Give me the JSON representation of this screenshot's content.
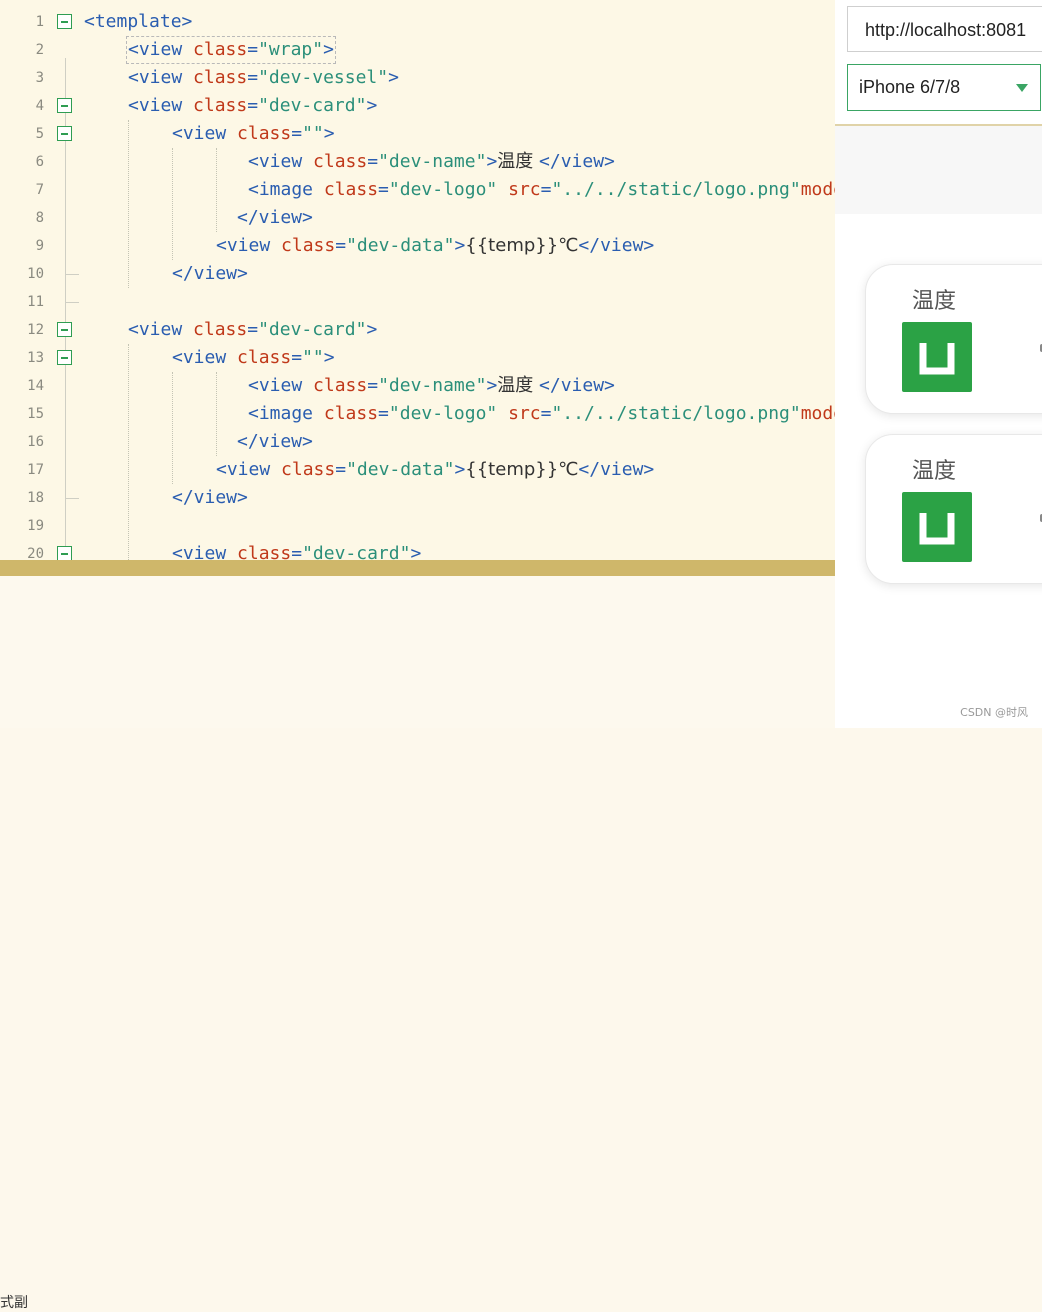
{
  "editor": {
    "lines": [
      {
        "n": "1",
        "fold": true,
        "indent": 84,
        "parts": [
          [
            "tag",
            "<template>"
          ]
        ]
      },
      {
        "n": "2",
        "fold": false,
        "indent": 128,
        "hl": true,
        "parts": [
          [
            "tag",
            "<view "
          ],
          [
            "attr",
            "class"
          ],
          [
            "tag",
            "="
          ],
          [
            "val",
            "\"wrap\""
          ],
          [
            "tag",
            ">"
          ]
        ]
      },
      {
        "n": "3",
        "fold": false,
        "indent": 128,
        "parts": [
          [
            "tag",
            "<view "
          ],
          [
            "attr",
            "class"
          ],
          [
            "tag",
            "="
          ],
          [
            "val",
            "\"dev-vessel\""
          ],
          [
            "tag",
            ">"
          ]
        ]
      },
      {
        "n": "4",
        "fold": true,
        "indent": 128,
        "parts": [
          [
            "tag",
            "<view "
          ],
          [
            "attr",
            "class"
          ],
          [
            "tag",
            "="
          ],
          [
            "val",
            "\"dev-card\""
          ],
          [
            "tag",
            ">"
          ]
        ]
      },
      {
        "n": "5",
        "fold": true,
        "indent": 172,
        "parts": [
          [
            "tag",
            "<view "
          ],
          [
            "attr",
            "class"
          ],
          [
            "tag",
            "="
          ],
          [
            "val",
            "\"\""
          ],
          [
            "tag",
            ">"
          ]
        ]
      },
      {
        "n": "6",
        "fold": false,
        "indent": 248,
        "parts": [
          [
            "tag",
            "<view "
          ],
          [
            "attr",
            "class"
          ],
          [
            "tag",
            "="
          ],
          [
            "val",
            "\"dev-name\""
          ],
          [
            "tag",
            ">"
          ],
          [
            "txt",
            "温度 "
          ],
          [
            "tag",
            "</view>"
          ]
        ]
      },
      {
        "n": "7",
        "fold": false,
        "indent": 248,
        "parts": [
          [
            "tag",
            "<image "
          ],
          [
            "attr",
            "class"
          ],
          [
            "tag",
            "="
          ],
          [
            "val",
            "\"dev-logo\""
          ],
          [
            "tag",
            " "
          ],
          [
            "attr",
            "src"
          ],
          [
            "tag",
            "="
          ],
          [
            "val",
            "\"../../static/logo.png\""
          ],
          [
            "attr",
            "mode"
          ]
        ]
      },
      {
        "n": "8",
        "fold": false,
        "indent": 237,
        "parts": [
          [
            "tag",
            "</view>"
          ]
        ]
      },
      {
        "n": "9",
        "fold": false,
        "indent": 216,
        "parts": [
          [
            "tag",
            "<view "
          ],
          [
            "attr",
            "class"
          ],
          [
            "tag",
            "="
          ],
          [
            "val",
            "\"dev-data\""
          ],
          [
            "tag",
            ">"
          ],
          [
            "txt",
            "{{temp}}℃"
          ],
          [
            "tag",
            "</view>"
          ]
        ]
      },
      {
        "n": "10",
        "fold": false,
        "indent": 172,
        "parts": [
          [
            "tag",
            "</view>"
          ]
        ]
      },
      {
        "n": "11",
        "fold": false,
        "indent": 0,
        "parts": []
      },
      {
        "n": "12",
        "fold": true,
        "indent": 128,
        "parts": [
          [
            "tag",
            "<view "
          ],
          [
            "attr",
            "class"
          ],
          [
            "tag",
            "="
          ],
          [
            "val",
            "\"dev-card\""
          ],
          [
            "tag",
            ">"
          ]
        ]
      },
      {
        "n": "13",
        "fold": true,
        "indent": 172,
        "parts": [
          [
            "tag",
            "<view "
          ],
          [
            "attr",
            "class"
          ],
          [
            "tag",
            "="
          ],
          [
            "val",
            "\"\""
          ],
          [
            "tag",
            ">"
          ]
        ]
      },
      {
        "n": "14",
        "fold": false,
        "indent": 248,
        "parts": [
          [
            "tag",
            "<view "
          ],
          [
            "attr",
            "class"
          ],
          [
            "tag",
            "="
          ],
          [
            "val",
            "\"dev-name\""
          ],
          [
            "tag",
            ">"
          ],
          [
            "txt",
            "温度 "
          ],
          [
            "tag",
            "</view>"
          ]
        ]
      },
      {
        "n": "15",
        "fold": false,
        "indent": 248,
        "parts": [
          [
            "tag",
            "<image "
          ],
          [
            "attr",
            "class"
          ],
          [
            "tag",
            "="
          ],
          [
            "val",
            "\"dev-logo\""
          ],
          [
            "tag",
            " "
          ],
          [
            "attr",
            "src"
          ],
          [
            "tag",
            "="
          ],
          [
            "val",
            "\"../../static/logo.png\""
          ],
          [
            "attr",
            "mode"
          ]
        ]
      },
      {
        "n": "16",
        "fold": false,
        "indent": 237,
        "parts": [
          [
            "tag",
            "</view>"
          ]
        ]
      },
      {
        "n": "17",
        "fold": false,
        "indent": 216,
        "parts": [
          [
            "tag",
            "<view "
          ],
          [
            "attr",
            "class"
          ],
          [
            "tag",
            "="
          ],
          [
            "val",
            "\"dev-data\""
          ],
          [
            "tag",
            ">"
          ],
          [
            "txt",
            "{{temp}}℃"
          ],
          [
            "tag",
            "</view>"
          ]
        ]
      },
      {
        "n": "18",
        "fold": false,
        "indent": 172,
        "parts": [
          [
            "tag",
            "</view>"
          ]
        ]
      },
      {
        "n": "19",
        "fold": false,
        "indent": 0,
        "parts": []
      },
      {
        "n": "20",
        "fold": true,
        "indent": 172,
        "parts": [
          [
            "tag",
            "<view "
          ],
          [
            "attr",
            "class"
          ],
          [
            "tag",
            "="
          ],
          [
            "val",
            "\"dev-card\""
          ],
          [
            "tag",
            ">"
          ]
        ]
      }
    ]
  },
  "bottom": {
    "cut_text": "式副"
  },
  "simulator": {
    "url": "http://localhost:8081",
    "device": "iPhone 6/7/8",
    "cards": [
      {
        "name": "温度"
      },
      {
        "name": "温度"
      }
    ],
    "watermark": "CSDN @时风"
  },
  "colors": {
    "tag": "#2a5db0",
    "attr": "#c0391a",
    "value": "#2b8f7a",
    "logo_green": "#2ba245",
    "splitter": "#cfb76a"
  },
  "icons": {
    "fold": "collapse-box-icon",
    "logo": "uniapp-logo-icon",
    "dropdown": "dropdown-arrow-icon"
  }
}
